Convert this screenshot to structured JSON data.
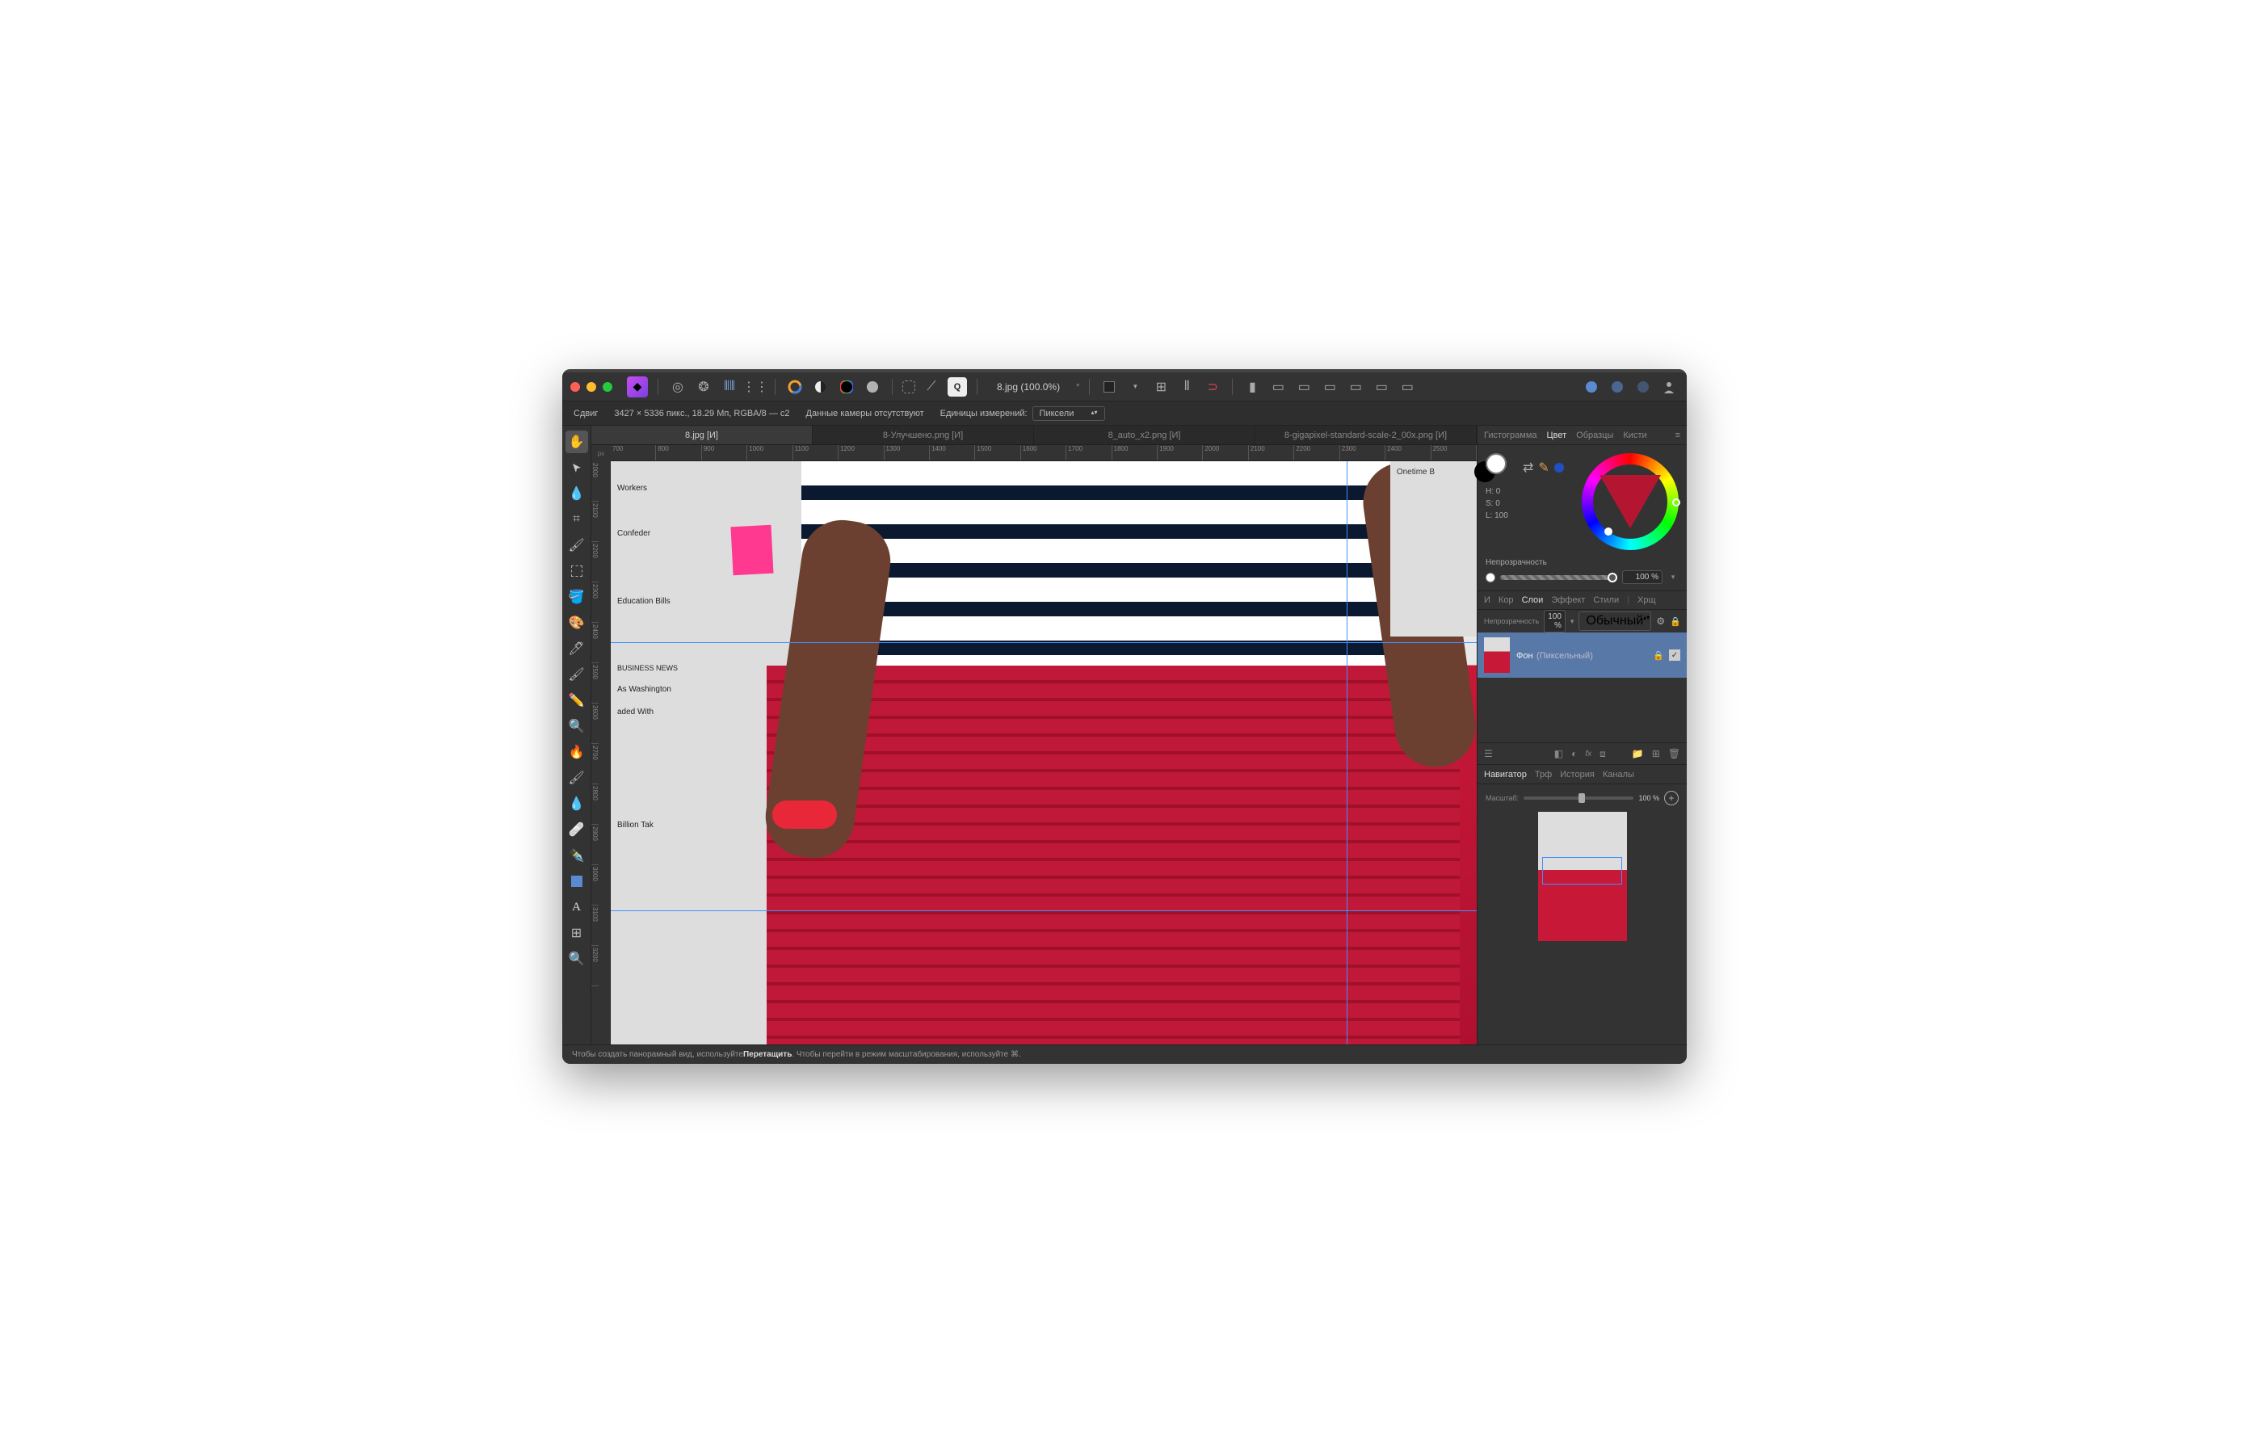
{
  "title": {
    "file": "8.jpg",
    "zoom": "(100.0%)",
    "modified": "*"
  },
  "info": {
    "mode": "Сдвиг",
    "dims": "3427 × 5336 пикс., 18.29 Мп, RGBA/8 — c2",
    "camera": "Данные камеры отсутствуют",
    "units_label": "Единицы измерений:",
    "units_value": "Пиксели"
  },
  "tabs": [
    "8.jpg [И]",
    "8-Улучшено.png [И]",
    "8_auto_x2.png [И]",
    "8-gigapixel-standard-scale-2_00x.png [И]"
  ],
  "ruler": {
    "unit": "px",
    "h": [
      "700",
      "800",
      "900",
      "1000",
      "1100",
      "1200",
      "1300",
      "1400",
      "1500",
      "1600",
      "1700",
      "1800",
      "1900",
      "2000",
      "2100",
      "2200",
      "2300",
      "2400",
      "2500"
    ],
    "v": [
      "2000",
      "2100",
      "2200",
      "2300",
      "2400",
      "2500",
      "2600",
      "2700",
      "2800",
      "2900",
      "3000",
      "3100",
      "3200"
    ]
  },
  "news_words": [
    "Workers",
    "Confeder",
    "Education Bills",
    "aded With",
    "Billion Tak",
    "BUSINESS NEWS",
    "As Washington",
    "Onetime B"
  ],
  "rpanels1": [
    "Гистограмма",
    "Цвет",
    "Образцы",
    "Кисти"
  ],
  "hsl": {
    "h": "H: 0",
    "s": "S: 0",
    "l": "L: 100"
  },
  "opacity": {
    "label": "Непрозрачность",
    "value": "100 %"
  },
  "rpanels2": [
    "И",
    "Кор",
    "Слои",
    "Эффект",
    "Стили",
    "Хрщ"
  ],
  "layerbar": {
    "op_label": "Непрозрачность",
    "op_value": "100 %",
    "blend": "Обычный"
  },
  "layer": {
    "name": "Фон",
    "type": "(Пиксельный)"
  },
  "rpanels3": [
    "Навигатор",
    "Трф",
    "История",
    "Каналы"
  ],
  "nav": {
    "label": "Масштаб:",
    "value": "100 %"
  },
  "status": {
    "t1": "Чтобы создать панорамный вид, используйте ",
    "b1": "Перетащить",
    "t2": ". Чтобы перейти в режим масштабирования, используйте ⌘."
  }
}
